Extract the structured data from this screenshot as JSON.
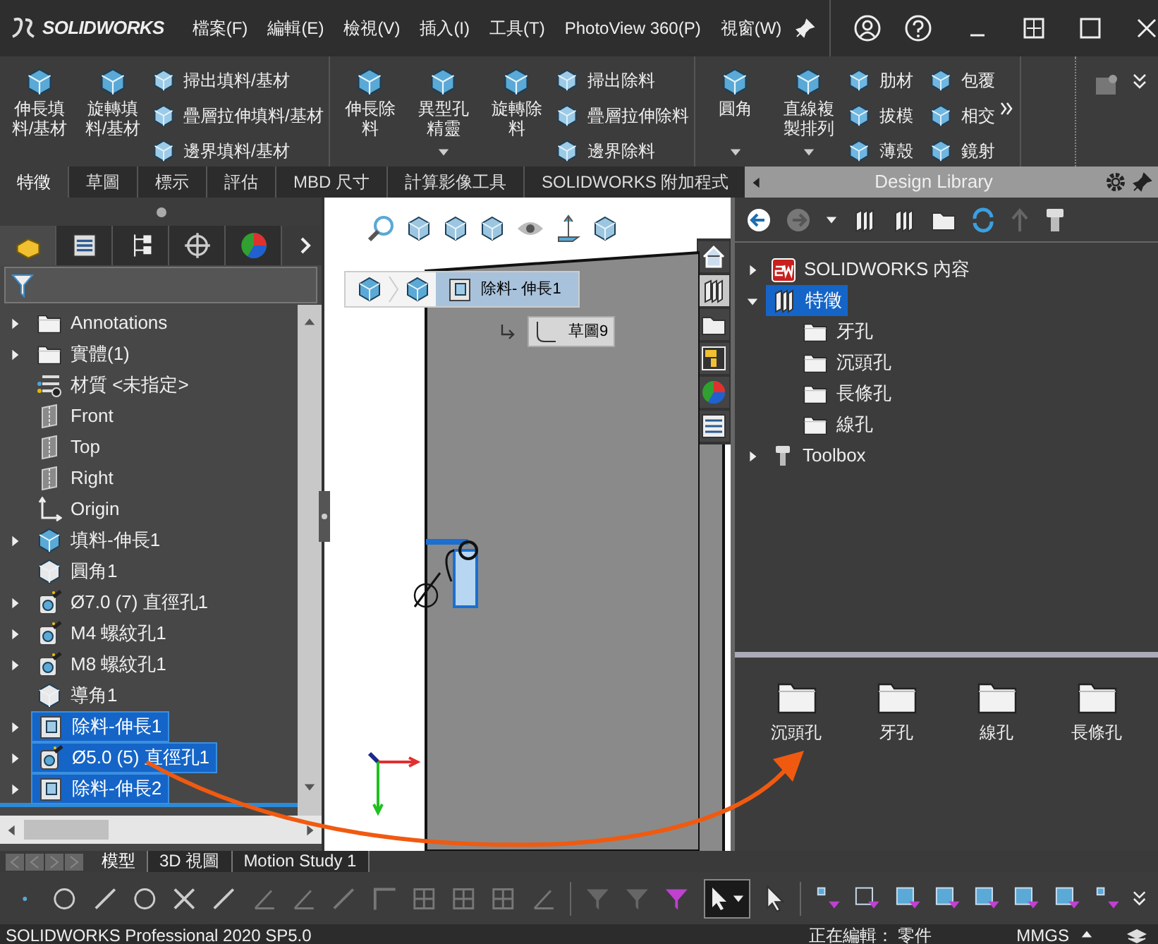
{
  "app": {
    "logo": "SOLIDWORKS"
  },
  "menu": [
    "檔案(F)",
    "編輯(E)",
    "檢視(V)",
    "插入(I)",
    "工具(T)",
    "PhotoView 360(P)",
    "視窗(W)"
  ],
  "ribbon": [
    {
      "items": [
        {
          "kind": "large",
          "label": "伸長填料/基材",
          "dropdown": false
        },
        {
          "kind": "large",
          "label": "旋轉填料/基材",
          "dropdown": false
        },
        {
          "kind": "small",
          "label": "掃出填料/基材"
        },
        {
          "kind": "small",
          "label": "疊層拉伸填料/基材"
        },
        {
          "kind": "small",
          "label": "邊界填料/基材"
        }
      ]
    },
    {
      "items": [
        {
          "kind": "large",
          "label": "伸長除料",
          "dropdown": false
        },
        {
          "kind": "large",
          "label": "異型孔精靈",
          "dropdown": true
        },
        {
          "kind": "large",
          "label": "旋轉除料",
          "dropdown": false
        },
        {
          "kind": "small",
          "label": "掃出除料"
        },
        {
          "kind": "small",
          "label": "疊層拉伸除料"
        },
        {
          "kind": "small",
          "label": "邊界除料"
        }
      ]
    },
    {
      "items": [
        {
          "kind": "large",
          "label": "圓角",
          "dropdown": true
        },
        {
          "kind": "large",
          "label": "直線複製排列",
          "dropdown": true
        },
        {
          "kind": "small",
          "label": "肋材"
        },
        {
          "kind": "small",
          "label": "拔模"
        },
        {
          "kind": "small",
          "label": "薄殼"
        },
        {
          "kind": "small",
          "label": "包覆"
        },
        {
          "kind": "small",
          "label": "相交"
        },
        {
          "kind": "small",
          "label": "鏡射"
        }
      ]
    }
  ],
  "command_tabs": [
    {
      "label": "特徵",
      "selected": true
    },
    {
      "label": "草圖",
      "selected": false
    },
    {
      "label": "標示",
      "selected": false
    },
    {
      "label": "評估",
      "selected": false
    },
    {
      "label": "MBD 尺寸",
      "selected": false
    },
    {
      "label": "計算影像工具",
      "selected": false
    },
    {
      "label": "SOLIDWORKS 附加程式",
      "selected": false
    }
  ],
  "panel_tabs": [
    {
      "kind": "tree",
      "selected": true
    },
    {
      "kind": "property",
      "selected": false
    },
    {
      "kind": "config",
      "selected": false
    },
    {
      "kind": "target",
      "selected": false
    },
    {
      "kind": "appearance",
      "selected": false
    }
  ],
  "feature_tree": [
    {
      "label": "Annotations",
      "kind": "annotation",
      "has_children": true,
      "selected": false
    },
    {
      "label": "實體(1)",
      "kind": "folder",
      "has_children": true,
      "selected": false
    },
    {
      "label": "材質 <未指定>",
      "kind": "material",
      "has_children": false,
      "selected": false
    },
    {
      "label": "Front",
      "kind": "plane",
      "has_children": false,
      "selected": false
    },
    {
      "label": "Top",
      "kind": "plane",
      "has_children": false,
      "selected": false
    },
    {
      "label": "Right",
      "kind": "plane",
      "has_children": false,
      "selected": false
    },
    {
      "label": "Origin",
      "kind": "origin",
      "has_children": false,
      "selected": false
    },
    {
      "label": "填料-伸長1",
      "kind": "boss",
      "has_children": true,
      "selected": false
    },
    {
      "label": "圓角1",
      "kind": "fillet",
      "has_children": false,
      "selected": false
    },
    {
      "label": "Ø7.0 (7) 直徑孔1",
      "kind": "hole",
      "has_children": true,
      "selected": false
    },
    {
      "label": "M4 螺紋孔1",
      "kind": "hole",
      "has_children": true,
      "selected": false
    },
    {
      "label": "M8 螺紋孔1",
      "kind": "hole",
      "has_children": true,
      "selected": false
    },
    {
      "label": "導角1",
      "kind": "fillet",
      "has_children": false,
      "selected": false
    },
    {
      "label": "除料-伸長1",
      "kind": "cut",
      "has_children": true,
      "selected": true
    },
    {
      "label": "Ø5.0 (5) 直徑孔1",
      "kind": "hole",
      "has_children": true,
      "selected": true
    },
    {
      "label": "除料-伸長2",
      "kind": "cut",
      "has_children": true,
      "selected": true
    }
  ],
  "breadcrumb": {
    "feature": "除料- 伸長1",
    "sketch": "草圖9"
  },
  "task_pane": [
    {
      "kind": "home",
      "selected": false
    },
    {
      "kind": "library",
      "selected": true
    },
    {
      "kind": "explorer",
      "selected": false
    },
    {
      "kind": "palette",
      "selected": false
    },
    {
      "kind": "appearance",
      "selected": false
    },
    {
      "kind": "properties",
      "selected": false
    }
  ],
  "design_library": {
    "title": "Design Library",
    "tree": [
      {
        "label": "SOLIDWORKS 內容",
        "kind": "sw",
        "expanded": false,
        "selected": false
      },
      {
        "label": "特徵",
        "kind": "library",
        "expanded": true,
        "selected": true,
        "children": [
          {
            "label": "牙孔",
            "kind": "folder"
          },
          {
            "label": "沉頭孔",
            "kind": "folder"
          },
          {
            "label": "長條孔",
            "kind": "folder"
          },
          {
            "label": "線孔",
            "kind": "folder"
          }
        ]
      },
      {
        "label": "Toolbox",
        "kind": "bolt",
        "expanded": false,
        "selected": false
      }
    ],
    "folders": [
      "沉頭孔",
      "牙孔",
      "線孔",
      "長條孔"
    ]
  },
  "bottom_tabs": [
    {
      "label": "模型",
      "selected": true
    },
    {
      "label": "3D 視圖",
      "selected": false
    },
    {
      "label": "Motion Study 1",
      "selected": false
    }
  ],
  "status_bar": {
    "product": "SOLIDWORKS Professional 2020 SP5.0",
    "mode": "正在編輯： 零件",
    "units": "MMGS"
  }
}
